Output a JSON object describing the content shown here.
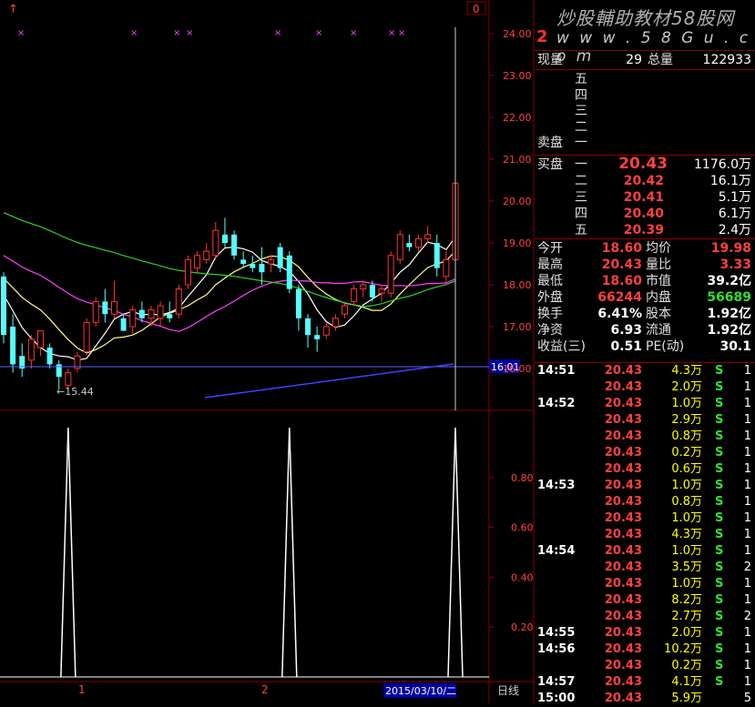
{
  "chart": {
    "top_marker": "↑",
    "corner_box": "0",
    "price_axis_labels": [
      "24.00",
      "23.00",
      "22.00",
      "21.00",
      "20.00",
      "19.00",
      "18.00",
      "17.00",
      "16.00"
    ],
    "current_price_tag": "16.01",
    "low_annotation": "←15.44",
    "indicator_axis_labels": [
      "0.80",
      "0.60",
      "0.40",
      "0.20"
    ],
    "bottom_labels": [
      "1",
      "2"
    ],
    "date_label": "2015/03/10/二",
    "period_label": "日线",
    "colors": {
      "up": "#ff3232",
      "down": "#54ffff",
      "grid": "#8a0000",
      "ma_white": "#ffffff",
      "ma_yellow": "#ffff80",
      "ma_magenta": "#ff40ff",
      "ma_green": "#30d030",
      "trend_blue": "#4040ff",
      "markers": "#ff40ff"
    }
  },
  "chart_data": {
    "type": "candlestick",
    "ylim": [
      15.2,
      24.5
    ],
    "candles": [
      {
        "o": 18.2,
        "h": 18.3,
        "l": 16.6,
        "c": 16.8
      },
      {
        "o": 17.0,
        "h": 17.3,
        "l": 15.9,
        "c": 16.1
      },
      {
        "o": 16.3,
        "h": 16.6,
        "l": 15.8,
        "c": 16.0
      },
      {
        "o": 16.2,
        "h": 16.8,
        "l": 16.0,
        "c": 16.7
      },
      {
        "o": 16.5,
        "h": 16.9,
        "l": 16.3,
        "c": 16.9
      },
      {
        "o": 16.5,
        "h": 16.6,
        "l": 16.0,
        "c": 16.1
      },
      {
        "o": 16.1,
        "h": 16.2,
        "l": 15.5,
        "c": 15.8
      },
      {
        "o": 15.6,
        "h": 16.0,
        "l": 15.44,
        "c": 15.9
      },
      {
        "o": 16.0,
        "h": 16.4,
        "l": 15.9,
        "c": 16.3
      },
      {
        "o": 16.4,
        "h": 17.2,
        "l": 16.3,
        "c": 17.1
      },
      {
        "o": 17.1,
        "h": 17.7,
        "l": 17.0,
        "c": 17.6
      },
      {
        "o": 17.6,
        "h": 17.9,
        "l": 17.1,
        "c": 17.3
      },
      {
        "o": 17.3,
        "h": 18.1,
        "l": 17.2,
        "c": 17.6
      },
      {
        "o": 17.2,
        "h": 17.3,
        "l": 16.9,
        "c": 16.9
      },
      {
        "o": 17.0,
        "h": 17.5,
        "l": 16.8,
        "c": 17.4
      },
      {
        "o": 17.4,
        "h": 17.6,
        "l": 17.1,
        "c": 17.2
      },
      {
        "o": 17.2,
        "h": 17.5,
        "l": 17.0,
        "c": 17.4
      },
      {
        "o": 17.2,
        "h": 17.6,
        "l": 17.0,
        "c": 17.5
      },
      {
        "o": 17.3,
        "h": 17.6,
        "l": 17.1,
        "c": 17.2
      },
      {
        "o": 17.3,
        "h": 18.0,
        "l": 17.2,
        "c": 17.9
      },
      {
        "o": 18.0,
        "h": 18.7,
        "l": 17.9,
        "c": 18.6
      },
      {
        "o": 18.4,
        "h": 18.8,
        "l": 18.3,
        "c": 18.7
      },
      {
        "o": 18.6,
        "h": 19.0,
        "l": 18.5,
        "c": 18.8
      },
      {
        "o": 18.7,
        "h": 19.5,
        "l": 18.6,
        "c": 19.3
      },
      {
        "o": 19.2,
        "h": 19.6,
        "l": 18.9,
        "c": 19.0
      },
      {
        "o": 19.2,
        "h": 19.3,
        "l": 18.6,
        "c": 18.7
      },
      {
        "o": 18.6,
        "h": 18.8,
        "l": 18.4,
        "c": 18.5
      },
      {
        "o": 18.5,
        "h": 18.7,
        "l": 18.3,
        "c": 18.4
      },
      {
        "o": 18.5,
        "h": 18.9,
        "l": 18.0,
        "c": 18.3
      },
      {
        "o": 18.5,
        "h": 18.7,
        "l": 18.3,
        "c": 18.6
      },
      {
        "o": 18.9,
        "h": 19.0,
        "l": 18.3,
        "c": 18.4
      },
      {
        "o": 18.7,
        "h": 18.8,
        "l": 17.8,
        "c": 17.9
      },
      {
        "o": 17.9,
        "h": 18.0,
        "l": 16.9,
        "c": 17.2
      },
      {
        "o": 17.2,
        "h": 17.3,
        "l": 16.5,
        "c": 16.8
      },
      {
        "o": 16.8,
        "h": 17.0,
        "l": 16.4,
        "c": 16.7
      },
      {
        "o": 16.8,
        "h": 17.1,
        "l": 16.7,
        "c": 17.0
      },
      {
        "o": 17.0,
        "h": 17.3,
        "l": 16.9,
        "c": 17.2
      },
      {
        "o": 17.3,
        "h": 17.6,
        "l": 17.2,
        "c": 17.5
      },
      {
        "o": 17.6,
        "h": 18.0,
        "l": 17.5,
        "c": 17.9
      },
      {
        "o": 17.9,
        "h": 18.1,
        "l": 17.7,
        "c": 18.0
      },
      {
        "o": 18.0,
        "h": 18.1,
        "l": 17.6,
        "c": 17.7
      },
      {
        "o": 17.8,
        "h": 18.0,
        "l": 17.6,
        "c": 17.9
      },
      {
        "o": 17.8,
        "h": 18.8,
        "l": 17.7,
        "c": 18.7
      },
      {
        "o": 18.6,
        "h": 19.3,
        "l": 18.5,
        "c": 19.2
      },
      {
        "o": 19.0,
        "h": 19.2,
        "l": 18.8,
        "c": 18.9
      },
      {
        "o": 18.9,
        "h": 19.2,
        "l": 18.8,
        "c": 19.1
      },
      {
        "o": 19.1,
        "h": 19.4,
        "l": 19.0,
        "c": 19.2
      },
      {
        "o": 19.0,
        "h": 19.2,
        "l": 18.2,
        "c": 18.4
      },
      {
        "o": 18.2,
        "h": 18.8,
        "l": 18.0,
        "c": 18.6
      },
      {
        "o": 18.6,
        "h": 20.43,
        "l": 18.6,
        "c": 20.43
      }
    ],
    "indicator": {
      "type": "line",
      "ylim": [
        0,
        1.0
      ],
      "spikes_at_index": [
        7,
        31,
        49
      ]
    }
  },
  "quote": {
    "code": "2",
    "watermark_line1": "炒股輔助教材58股网",
    "watermark_line2": "w w w . 5 8 G u . c o m",
    "now_vol_label": "现量",
    "now_vol": "29",
    "total_vol_label": "总量",
    "total_vol": "122933",
    "sell_label": "卖盘",
    "sell_levels": [
      "五",
      "四",
      "三",
      "二",
      "一"
    ],
    "buy_label": "买盘",
    "buy_levels": [
      {
        "level": "一",
        "price": "20.43",
        "vol": "1176.0万"
      },
      {
        "level": "二",
        "price": "20.42",
        "vol": "16.1万"
      },
      {
        "level": "三",
        "price": "20.41",
        "vol": "5.1万"
      },
      {
        "level": "四",
        "price": "20.40",
        "vol": "6.1万"
      },
      {
        "level": "五",
        "price": "20.39",
        "vol": "2.4万"
      }
    ],
    "stats": [
      {
        "l1": "今开",
        "v1": "18.60",
        "c1": "red",
        "l2": "均价",
        "v2": "19.98",
        "c2": "red"
      },
      {
        "l1": "最高",
        "v1": "20.43",
        "c1": "red",
        "l2": "量比",
        "v2": "3.33",
        "c2": "red"
      },
      {
        "l1": "最低",
        "v1": "18.60",
        "c1": "red",
        "l2": "市值",
        "v2": "39.2亿",
        "c2": "white"
      },
      {
        "l1": "外盘",
        "v1": "66244",
        "c1": "red",
        "l2": "内盘",
        "v2": "56689",
        "c2": "green"
      },
      {
        "l1": "换手",
        "v1": "6.41%",
        "c1": "white",
        "l2": "股本",
        "v2": "1.92亿",
        "c2": "white"
      },
      {
        "l1": "净资",
        "v1": "6.93",
        "c1": "white",
        "l2": "流通",
        "v2": "1.92亿",
        "c2": "white"
      },
      {
        "l1": "收益(三)",
        "v1": "0.51",
        "c1": "white",
        "l2": "PE(动)",
        "v2": "30.1",
        "c2": "white"
      }
    ],
    "trades": [
      {
        "t": "14:51",
        "p": "20.43",
        "v": "4.3万",
        "s": "S",
        "n": "1"
      },
      {
        "t": "",
        "p": "20.43",
        "v": "2.0万",
        "s": "S",
        "n": "1"
      },
      {
        "t": "14:52",
        "p": "20.43",
        "v": "1.0万",
        "s": "S",
        "n": "1"
      },
      {
        "t": "",
        "p": "20.43",
        "v": "2.9万",
        "s": "S",
        "n": "1"
      },
      {
        "t": "",
        "p": "20.43",
        "v": "0.8万",
        "s": "S",
        "n": "1"
      },
      {
        "t": "",
        "p": "20.43",
        "v": "0.2万",
        "s": "S",
        "n": "1"
      },
      {
        "t": "",
        "p": "20.43",
        "v": "0.6万",
        "s": "S",
        "n": "1"
      },
      {
        "t": "14:53",
        "p": "20.43",
        "v": "1.0万",
        "s": "S",
        "n": "1"
      },
      {
        "t": "",
        "p": "20.43",
        "v": "0.8万",
        "s": "S",
        "n": "1"
      },
      {
        "t": "",
        "p": "20.43",
        "v": "1.0万",
        "s": "S",
        "n": "1"
      },
      {
        "t": "",
        "p": "20.43",
        "v": "4.3万",
        "s": "S",
        "n": "1"
      },
      {
        "t": "14:54",
        "p": "20.43",
        "v": "1.0万",
        "s": "S",
        "n": "1"
      },
      {
        "t": "",
        "p": "20.43",
        "v": "3.5万",
        "s": "S",
        "n": "2"
      },
      {
        "t": "",
        "p": "20.43",
        "v": "1.0万",
        "s": "S",
        "n": "1"
      },
      {
        "t": "",
        "p": "20.43",
        "v": "8.2万",
        "s": "S",
        "n": "1"
      },
      {
        "t": "",
        "p": "20.43",
        "v": "2.7万",
        "s": "S",
        "n": "2"
      },
      {
        "t": "14:55",
        "p": "20.43",
        "v": "2.0万",
        "s": "S",
        "n": "1"
      },
      {
        "t": "14:56",
        "p": "20.43",
        "v": "10.2万",
        "s": "S",
        "n": "1"
      },
      {
        "t": "",
        "p": "20.43",
        "v": "0.2万",
        "s": "S",
        "n": "1"
      },
      {
        "t": "14:57",
        "p": "20.43",
        "v": "4.1万",
        "s": "S",
        "n": "1"
      },
      {
        "t": "15:00",
        "p": "20.43",
        "v": "5.9万",
        "s": "",
        "n": "5"
      }
    ]
  }
}
